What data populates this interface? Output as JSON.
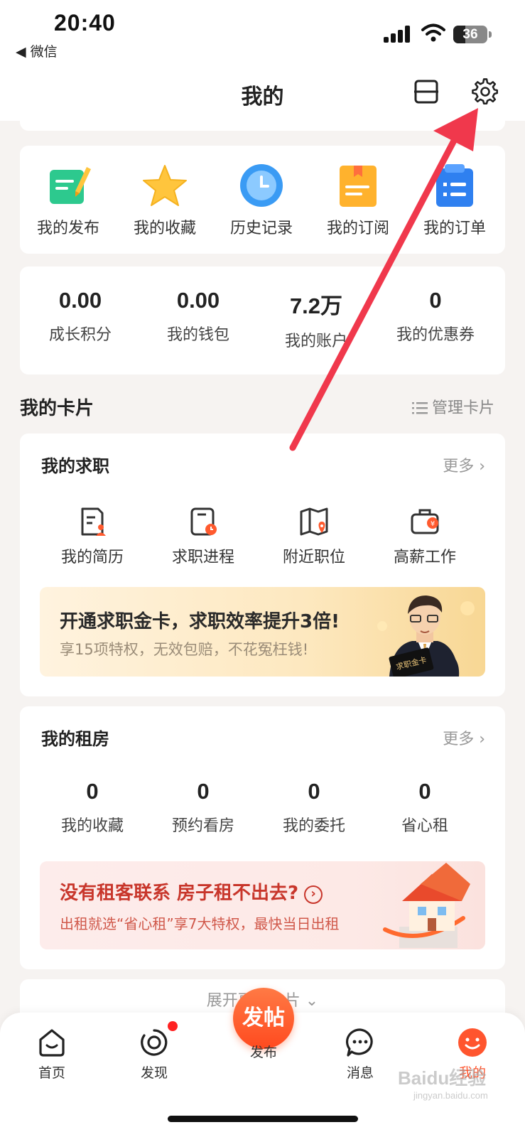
{
  "status_bar": {
    "time": "20:40",
    "back_app": "◀ 微信",
    "battery": "36"
  },
  "header": {
    "title": "我的"
  },
  "quick_links": [
    {
      "label": "我的发布",
      "icon": "post-note-icon"
    },
    {
      "label": "我的收藏",
      "icon": "star-icon"
    },
    {
      "label": "历史记录",
      "icon": "clock-icon"
    },
    {
      "label": "我的订阅",
      "icon": "subscription-icon"
    },
    {
      "label": "我的订单",
      "icon": "order-icon"
    }
  ],
  "stats": [
    {
      "value": "0.00",
      "label": "成长积分"
    },
    {
      "value": "0.00",
      "label": "我的钱包"
    },
    {
      "value": "7.2万",
      "label": "我的账户"
    },
    {
      "value": "0",
      "label": "我的优惠券"
    }
  ],
  "cards_section": {
    "title": "我的卡片",
    "manage_label": "管理卡片"
  },
  "job_card": {
    "title": "我的求职",
    "more": "更多 ›",
    "items": [
      {
        "label": "我的简历",
        "icon": "resume-icon"
      },
      {
        "label": "求职进程",
        "icon": "job-progress-icon"
      },
      {
        "label": "附近职位",
        "icon": "map-pin-icon"
      },
      {
        "label": "高薪工作",
        "icon": "briefcase-icon"
      }
    ],
    "banner": {
      "title": "开通求职金卡，求职效率提升3倍!",
      "subtitle": "享15项特权，无效包赔，不花冤枉钱!",
      "card_text": "求职金卡"
    }
  },
  "rent_card": {
    "title": "我的租房",
    "more": "更多 ›",
    "stats": [
      {
        "value": "0",
        "label": "我的收藏"
      },
      {
        "value": "0",
        "label": "预约看房"
      },
      {
        "value": "0",
        "label": "我的委托"
      },
      {
        "value": "0",
        "label": "省心租"
      }
    ],
    "banner": {
      "title": "没有租客联系 房子租不出去?",
      "arrow": "›",
      "subtitle": "出租就选“省心租”享7大特权，最快当日出租"
    }
  },
  "expand_label": "展开更多卡片 ⌄",
  "tabs": [
    {
      "label": "首页",
      "icon": "home-icon",
      "active": false
    },
    {
      "label": "发现",
      "icon": "discover-icon",
      "active": false
    },
    {
      "label": "发布",
      "icon": "post-icon",
      "active": false
    },
    {
      "label": "消息",
      "icon": "message-icon",
      "active": false
    },
    {
      "label": "我的",
      "icon": "profile-icon",
      "active": true
    }
  ],
  "post_button": "发帖",
  "watermark": {
    "brand": "Baidu经验",
    "url": "jingyan.baidu.com"
  },
  "colors": {
    "accent": "#ff552e",
    "arrow": "#f0384c",
    "promo_red": "#c8362b"
  }
}
